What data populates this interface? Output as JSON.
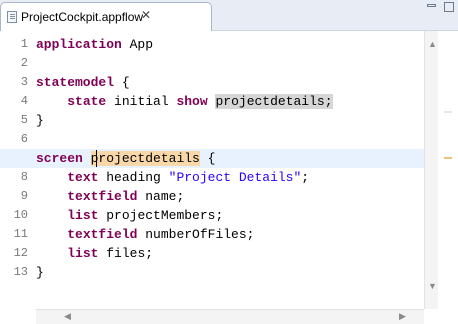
{
  "tab": {
    "title": "ProjectCockpit.appflow",
    "close_glyph": "✕",
    "icon": "file-icon"
  },
  "window_controls": {
    "minimize": "minimize-icon",
    "maximize": "maximize-icon"
  },
  "editor": {
    "line_numbers": [
      "1",
      "2",
      "3",
      "4",
      "5",
      "6",
      "7",
      "8",
      "9",
      "10",
      "11",
      "12",
      "13"
    ],
    "code": {
      "l1_kw": "application",
      "l1_rest": " App",
      "l3_kw": "statemodel",
      "l3_rest": " {",
      "l4_indent": "    ",
      "l4_kw1": "state",
      "l4_mid1": " initial ",
      "l4_kw2": "show",
      "l4_sp": " ",
      "l4_id": "projectdetails",
      "l4_end": ";",
      "l5": "}",
      "l7_kw": "screen",
      "l7_sp": " ",
      "l7_id": "projectdetails",
      "l7_end": " {",
      "l8_indent": "    ",
      "l8_kw": "text",
      "l8_mid": " heading ",
      "l8_str": "\"Project Details\"",
      "l8_end": ";",
      "l9_indent": "    ",
      "l9_kw": "textfield",
      "l9_rest": " name;",
      "l10_indent": "    ",
      "l10_kw": "list",
      "l10_rest": " projectMembers;",
      "l11_indent": "    ",
      "l11_kw": "textfield",
      "l11_rest": " numberOfFiles;",
      "l12_indent": "    ",
      "l12_kw": "list",
      "l12_rest": " files;",
      "l13": "}"
    },
    "colors": {
      "keyword": "#7f0055",
      "string": "#2a00ff",
      "current_line": "#e8f2fe",
      "occurrence_highlight": "#d6d6d6",
      "selection_highlight": "#f8d7a8"
    }
  },
  "scrollbars": {
    "up": "▲",
    "down": "▼",
    "left": "◀",
    "right": "▶"
  }
}
